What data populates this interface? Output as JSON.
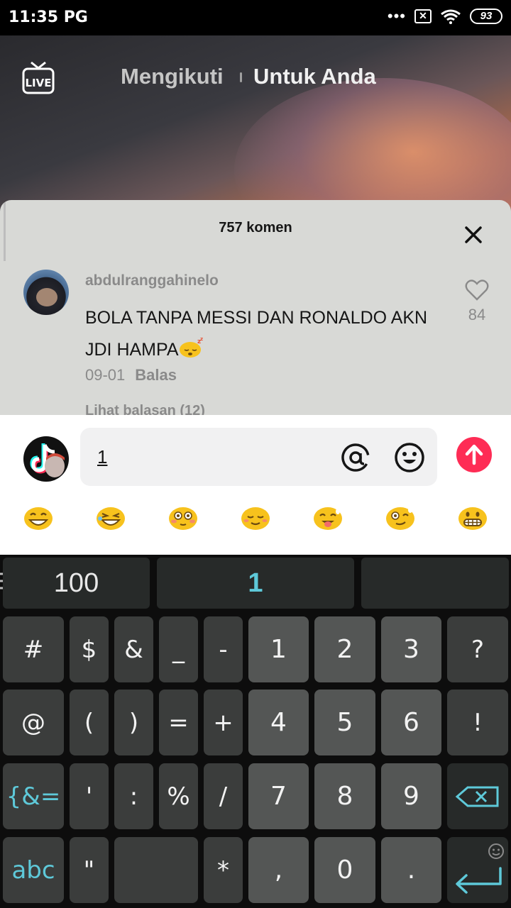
{
  "status_bar": {
    "time": "11:35 PG",
    "dots": "•••",
    "sim": "✕",
    "battery": "93"
  },
  "top_nav": {
    "following": "Mengikuti",
    "for_you": "Untuk Anda"
  },
  "comments": {
    "title": "757 komen",
    "items": [
      {
        "user": "abdulranggahinelo",
        "text": "BOLA TANPA MESSI DAN RONALDO AKN JDI HAMPA",
        "date": "09-01",
        "reply_label": "Balas",
        "likes": "84",
        "view_replies": "Lihat balasan (12)"
      }
    ]
  },
  "input": {
    "value": "1"
  },
  "emoji_icons": [
    "grinning-face-icon",
    "grinning-squint-icon",
    "flushed-face-icon",
    "relieved-face-icon",
    "tongue-face-icon",
    "heart-eyes-icon",
    "grimacing-face-icon"
  ],
  "keyboard": {
    "suggestions": [
      "100",
      "1",
      ""
    ],
    "rows": [
      [
        "#",
        "$",
        "&",
        "_",
        "-",
        "1",
        "2",
        "3",
        "?"
      ],
      [
        "@",
        "(",
        ")",
        "=",
        "+",
        "4",
        "5",
        "6",
        "!"
      ],
      [
        "{&=",
        "'",
        ":",
        "%",
        "/",
        "7",
        "8",
        "9",
        "⌫"
      ],
      [
        "abc",
        "\"",
        "",
        "*",
        ",",
        "0",
        ".",
        "↵"
      ]
    ]
  },
  "colors": {
    "accent_red": "#fe2c55",
    "keyboard_teal": "#5ec9d9",
    "sheet_bg": "#d8d9d6"
  }
}
